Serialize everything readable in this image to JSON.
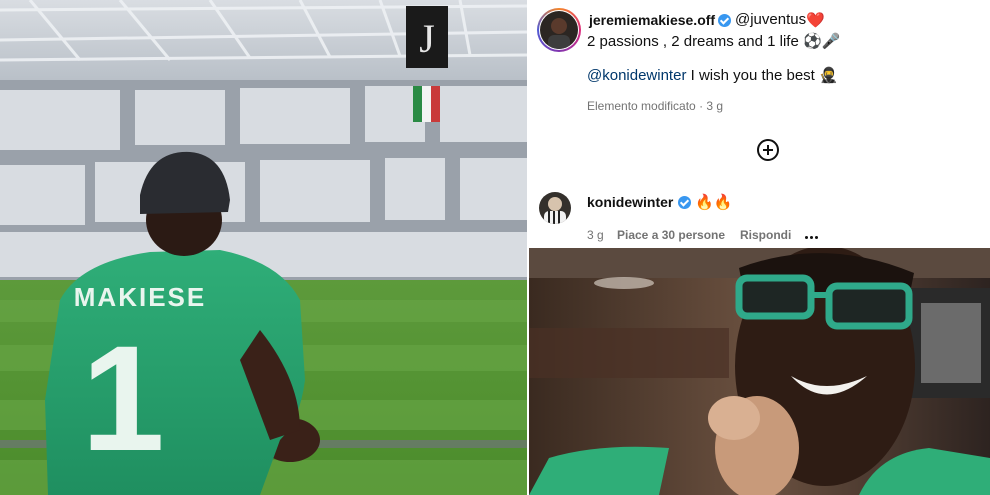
{
  "left_photo": {
    "jersey_name": "MAKIESE",
    "jersey_number": "1"
  },
  "post": {
    "username": "jeremiemakiese.off",
    "mention": "@juventus",
    "heart_emoji": "❤️",
    "caption_line1": "2 passions , 2 dreams and 1 life ⚽️🎤",
    "caption_mention": "@konidewinter",
    "caption_line2_rest": " I wish you the best 🥷",
    "edited_label": "Elemento modificato",
    "edited_time": "3 g"
  },
  "comment": {
    "username": "konidewinter",
    "text": "🔥🔥",
    "time": "3 g",
    "likes": "Piace a 30 persone",
    "reply_label": "Rispondi"
  },
  "colors": {
    "verified": "#3897f0",
    "mention": "#00376b",
    "meta": "#737373"
  }
}
